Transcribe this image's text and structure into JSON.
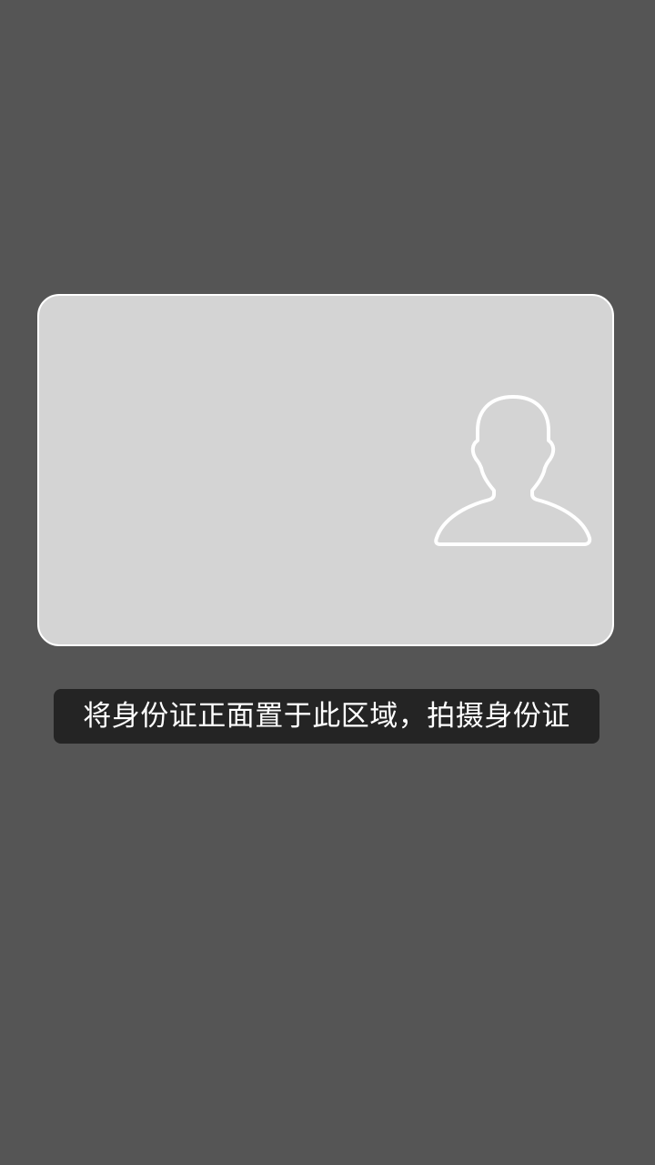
{
  "hint": {
    "text": "将身份证正面置于此区域，拍摄身份证"
  },
  "colors": {
    "background": "#555555",
    "card_fill": "#d4d4d4",
    "card_border": "#ffffff",
    "hint_background": "#242424",
    "hint_text": "#ffffff"
  },
  "icons": {
    "portrait": "person-silhouette-icon"
  }
}
